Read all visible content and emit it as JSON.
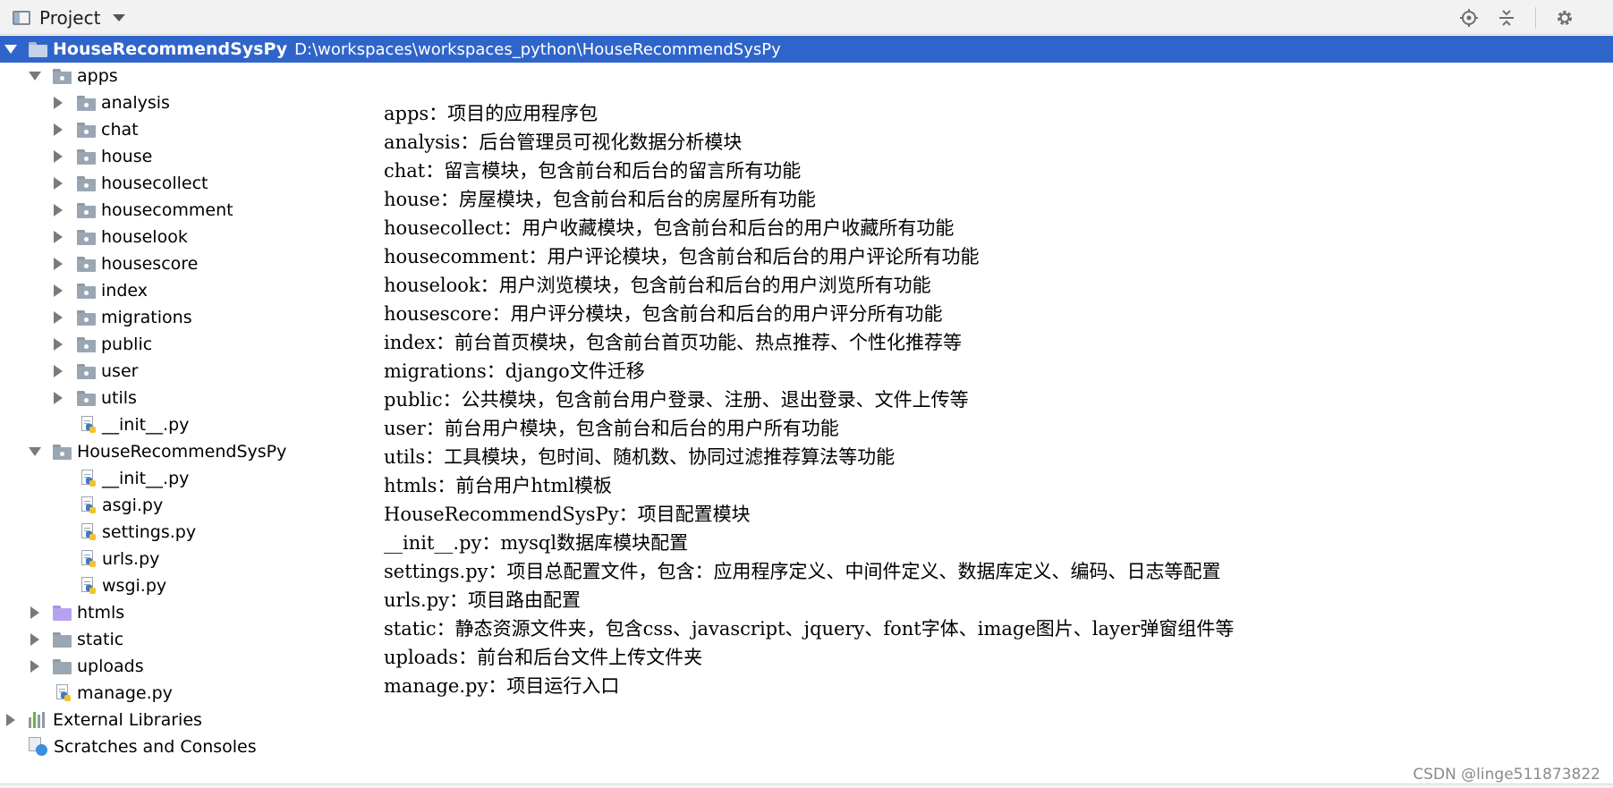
{
  "toolbar": {
    "title": "Project",
    "icons": [
      "project-view-icon",
      "dropdown-caret-icon",
      "locate-icon",
      "collapse-all-icon",
      "settings-gear-icon"
    ]
  },
  "tree": {
    "root": {
      "name": "HouseRecommendSysPy",
      "path": "D:\\workspaces\\workspaces_python\\HouseRecommendSysPy"
    },
    "apps_label": "apps",
    "apps_children": [
      "analysis",
      "chat",
      "house",
      "housecollect",
      "housecomment",
      "houselook",
      "housescore",
      "index",
      "migrations",
      "public",
      "user",
      "utils"
    ],
    "apps_init": "__init__.py",
    "config_label": "HouseRecommendSysPy",
    "config_files": [
      "__init__.py",
      "asgi.py",
      "settings.py",
      "urls.py",
      "wsgi.py"
    ],
    "htmls": "htmls",
    "static": "static",
    "uploads": "uploads",
    "manage": "manage.py",
    "external_libraries": "External Libraries",
    "scratches": "Scratches and Consoles"
  },
  "notes": [
    "apps：项目的应用程序包",
    "analysis：后台管理员可视化数据分析模块",
    "chat：留言模块，包含前台和后台的留言所有功能",
    "house：房屋模块，包含前台和后台的房屋所有功能",
    "housecollect：用户收藏模块，包含前台和后台的用户收藏所有功能",
    "housecomment：用户评论模块，包含前台和后台的用户评论所有功能",
    "houselook：用户浏览模块，包含前台和后台的用户浏览所有功能",
    "housescore：用户评分模块，包含前台和后台的用户评分所有功能",
    "index：前台首页模块，包含前台首页功能、热点推荐、个性化推荐等",
    "migrations：django文件迁移",
    "public：公共模块，包含前台用户登录、注册、退出登录、文件上传等",
    "user：前台用户模块，包含前台和后台的用户所有功能",
    "utils：工具模块，包时间、随机数、协同过滤推荐算法等功能",
    "htmls：前台用户html模板",
    "HouseRecommendSysPy：项目配置模块",
    "__init__.py：mysql数据库模块配置",
    "settings.py：项目总配置文件，包含：应用程序定义、中间件定义、数据库定义、编码、日志等配置",
    "urls.py：项目路由配置",
    "static：静态资源文件夹，包含css、javascript、jquery、font字体、image图片、layer弹窗组件等",
    "uploads：前台和后台文件上传文件夹",
    "manage.py：项目运行入口"
  ],
  "watermark": "CSDN @linge511873822"
}
